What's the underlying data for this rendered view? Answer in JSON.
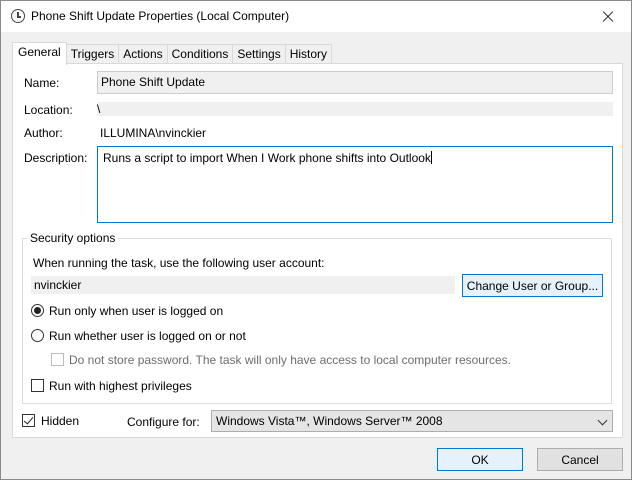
{
  "window": {
    "title": "Phone Shift Update Properties (Local Computer)"
  },
  "tabs": [
    {
      "label": "General",
      "active": true
    },
    {
      "label": "Triggers",
      "active": false
    },
    {
      "label": "Actions",
      "active": false
    },
    {
      "label": "Conditions",
      "active": false
    },
    {
      "label": "Settings",
      "active": false
    },
    {
      "label": "History",
      "active": false
    }
  ],
  "general": {
    "name_label": "Name:",
    "name_value": "Phone Shift Update",
    "location_label": "Location:",
    "location_value": "\\",
    "author_label": "Author:",
    "author_value": "ILLUMINA\\nvinckier",
    "description_label": "Description:",
    "description_value": "Runs a script to import When I Work phone shifts into Outlook"
  },
  "security": {
    "legend": "Security options",
    "account_prompt": "When running the task, use the following user account:",
    "user_account": "nvinckier",
    "change_user_button": "Change User or Group...",
    "radio_logged_on": {
      "label": "Run only when user is logged on",
      "checked": true
    },
    "radio_whether": {
      "label": "Run whether user is logged on or not",
      "checked": false
    },
    "no_store_password": {
      "label": "Do not store password.  The task will only have access to local computer resources.",
      "checked": false,
      "enabled": false
    },
    "highest_privileges": {
      "label": "Run with highest privileges",
      "checked": false
    }
  },
  "bottom": {
    "hidden": {
      "label": "Hidden",
      "checked": true
    },
    "configure_label": "Configure for:",
    "configure_value": "Windows Vista™, Windows Server™ 2008"
  },
  "buttons": {
    "ok": "OK",
    "cancel": "Cancel"
  },
  "colors": {
    "accent": "#0078d7",
    "dialog_bg": "#f0f0f0"
  }
}
